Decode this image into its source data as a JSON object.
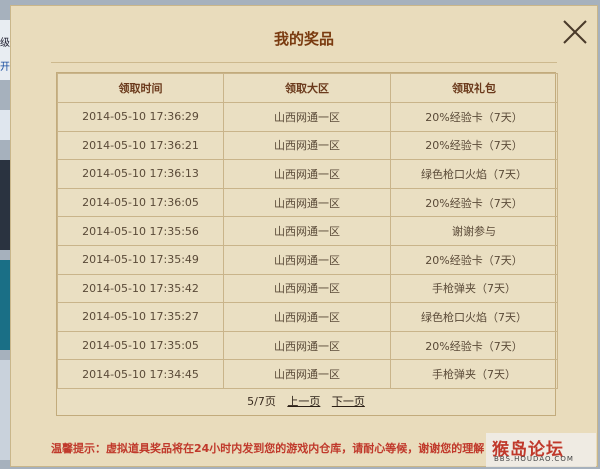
{
  "background": {
    "fragment1": "级害",
    "fragment2": "开"
  },
  "modal": {
    "title": "我的奖品",
    "close_icon": "close-icon"
  },
  "table": {
    "headers": [
      "领取时间",
      "领取大区",
      "领取礼包"
    ],
    "rows": [
      [
        "2014-05-10 17:36:29",
        "山西网通一区",
        "20%经验卡（7天）"
      ],
      [
        "2014-05-10 17:36:21",
        "山西网通一区",
        "20%经验卡（7天）"
      ],
      [
        "2014-05-10 17:36:13",
        "山西网通一区",
        "绿色枪口火焰（7天）"
      ],
      [
        "2014-05-10 17:36:05",
        "山西网通一区",
        "20%经验卡（7天）"
      ],
      [
        "2014-05-10 17:35:56",
        "山西网通一区",
        "谢谢参与"
      ],
      [
        "2014-05-10 17:35:49",
        "山西网通一区",
        "20%经验卡（7天）"
      ],
      [
        "2014-05-10 17:35:42",
        "山西网通一区",
        "手枪弹夹（7天）"
      ],
      [
        "2014-05-10 17:35:27",
        "山西网通一区",
        "绿色枪口火焰（7天）"
      ],
      [
        "2014-05-10 17:35:05",
        "山西网通一区",
        "20%经验卡（7天）"
      ],
      [
        "2014-05-10 17:34:45",
        "山西网通一区",
        "手枪弹夹（7天）"
      ]
    ]
  },
  "pager": {
    "page_info": "5/7页",
    "prev": "上一页",
    "next": "下一页"
  },
  "notice": "温馨提示：虚拟道具奖品将在24小时内发到您的游戏内仓库，请耐心等候，谢谢您的理解",
  "watermark": {
    "text": "猴岛论坛",
    "url": "BBS.HOUDAO.COM"
  }
}
